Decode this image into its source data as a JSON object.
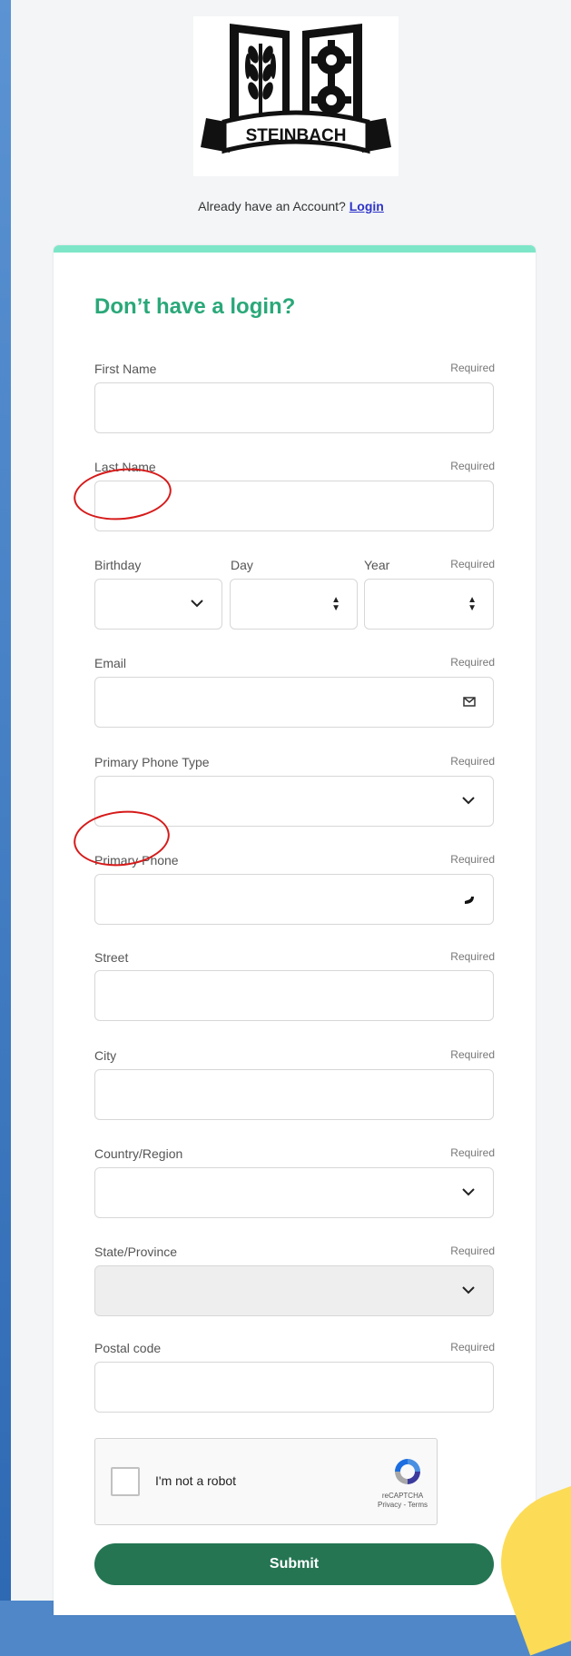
{
  "header": {
    "logo_text": "STEINBACH",
    "already_text": "Already have an Account?",
    "login_link": "Login"
  },
  "form": {
    "title": "Don’t have a login?",
    "required_label": "Required",
    "fields": {
      "first_name": "First Name",
      "last_name": "Last Name",
      "birthday": "Birthday",
      "day": "Day",
      "year": "Year",
      "email": "Email",
      "phone_type": "Primary Phone Type",
      "phone": "Primary Phone",
      "street": "Street",
      "city": "City",
      "country": "Country/Region",
      "state": "State/Province",
      "postal": "Postal code"
    },
    "captcha": {
      "label": "I'm not a robot",
      "brand": "reCAPTCHA",
      "links": "Privacy - Terms"
    },
    "submit_label": "Submit"
  },
  "colors": {
    "background": "#4f87c9",
    "accent_green": "#2aa879",
    "submit_green": "#257553",
    "card_top_border": "#7ee6c8",
    "annotation_red": "#d61a1a",
    "yellow_shape": "#fcdb57"
  },
  "icons": [
    "chevron-down-icon",
    "spinner-arrows-icon",
    "mail-icon",
    "phone-icon",
    "recaptcha-icon"
  ]
}
